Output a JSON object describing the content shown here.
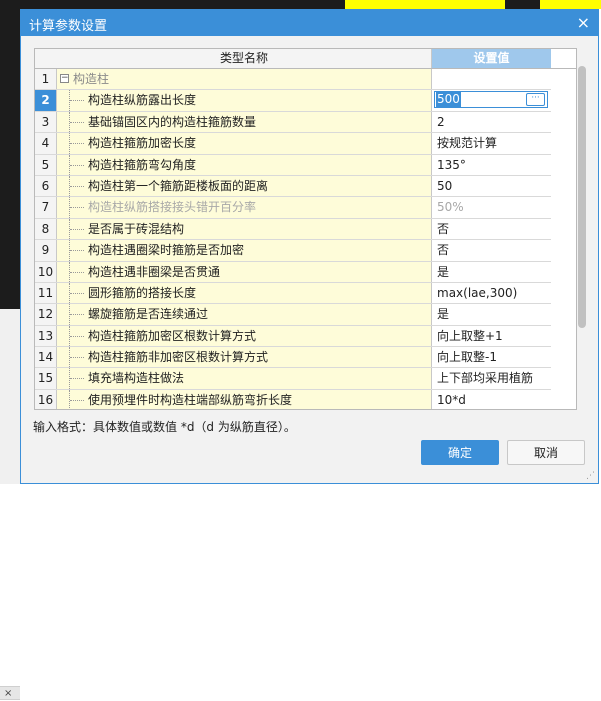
{
  "background": {
    "left_tab_label": "×"
  },
  "dialog": {
    "title": "计算参数设置",
    "close_glyph": "×",
    "table": {
      "headers": {
        "name": "类型名称",
        "value": "设置值"
      },
      "rows": [
        {
          "num": "1",
          "name": "构造柱",
          "value": "",
          "kind": "group",
          "expander": "−"
        },
        {
          "num": "2",
          "name": "构造柱纵筋露出长度",
          "value": "500",
          "kind": "selected"
        },
        {
          "num": "3",
          "name": "基础锚固区内的构造柱箍筋数量",
          "value": "2",
          "kind": "normal"
        },
        {
          "num": "4",
          "name": "构造柱箍筋加密长度",
          "value": "按规范计算",
          "kind": "normal"
        },
        {
          "num": "5",
          "name": "构造柱箍筋弯勾角度",
          "value": "135°",
          "kind": "normal"
        },
        {
          "num": "6",
          "name": "构造柱第一个箍筋距楼板面的距离",
          "value": "50",
          "kind": "normal"
        },
        {
          "num": "7",
          "name": "构造柱纵筋搭接接头错开百分率",
          "value": "50%",
          "kind": "disabled"
        },
        {
          "num": "8",
          "name": "是否属于砖混结构",
          "value": "否",
          "kind": "normal"
        },
        {
          "num": "9",
          "name": "构造柱遇圈梁时箍筋是否加密",
          "value": "否",
          "kind": "normal"
        },
        {
          "num": "10",
          "name": "构造柱遇非圈梁是否贯通",
          "value": "是",
          "kind": "normal"
        },
        {
          "num": "11",
          "name": "圆形箍筋的搭接长度",
          "value": "max(lae,300)",
          "kind": "normal"
        },
        {
          "num": "12",
          "name": "螺旋箍筋是否连续通过",
          "value": "是",
          "kind": "normal"
        },
        {
          "num": "13",
          "name": "构造柱箍筋加密区根数计算方式",
          "value": "向上取整+1",
          "kind": "normal"
        },
        {
          "num": "14",
          "name": "构造柱箍筋非加密区根数计算方式",
          "value": "向上取整-1",
          "kind": "normal"
        },
        {
          "num": "15",
          "name": "填充墙构造柱做法",
          "value": "上下部均采用植筋",
          "kind": "normal"
        },
        {
          "num": "16",
          "name": "使用预埋件时构造柱端部纵筋弯折长度",
          "value": "10*d",
          "kind": "normal"
        }
      ],
      "editor_button": "···"
    },
    "hint": "输入格式：具体数值或数值 *d（d 为纵筋直径）。",
    "buttons": {
      "ok": "确定",
      "cancel": "取消"
    }
  },
  "colors": {
    "accent": "#3b8fd8",
    "name_cell_bg": "#fefcd9",
    "header_value_bg": "#9fc8ec"
  }
}
